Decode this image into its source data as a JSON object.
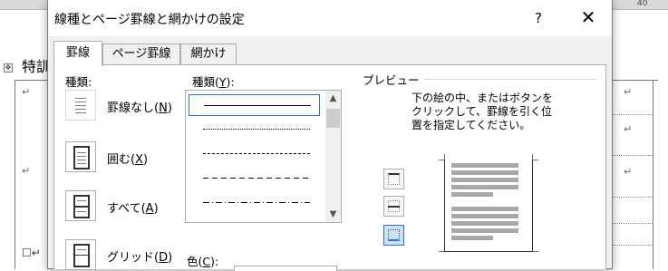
{
  "document": {
    "ruler_number": "40",
    "text_fragment": "特訓",
    "paragraph_mark": "↵",
    "checkbox_row_mark": "☐↵"
  },
  "dialog": {
    "title": "線種とページ罫線と網かけの設定",
    "help_label": "?",
    "close_label": "✕",
    "tabs": [
      {
        "label": "罫線",
        "active": true
      },
      {
        "label": "ページ罫線",
        "active": false
      },
      {
        "label": "網かけ",
        "active": false
      }
    ],
    "settings": {
      "label": "種類:",
      "items": [
        {
          "label": "罫線なし(N)",
          "base": "罫線なし(",
          "key": "N",
          "end": ")",
          "icon": "no-border-icon"
        },
        {
          "label": "囲む(X)",
          "base": "囲む(",
          "key": "X",
          "end": ")",
          "icon": "box-border-icon"
        },
        {
          "label": "すべて(A)",
          "base": "すべて(",
          "key": "A",
          "end": ")",
          "icon": "all-borders-icon"
        },
        {
          "label": "グリッド(D)",
          "base": "グリッド(",
          "key": "D",
          "end": ")",
          "icon": "grid-border-icon"
        }
      ]
    },
    "style": {
      "label": "種類(Y):",
      "label_base": "種類(",
      "label_key": "Y",
      "label_end": "):",
      "items": [
        "solid",
        "dotted",
        "dashed-small",
        "dashed",
        "dash-dot"
      ],
      "selected": "solid"
    },
    "color": {
      "label": "色(C):",
      "label_base": "色(",
      "label_key": "C",
      "label_end": "):"
    },
    "preview": {
      "label": "プレビュー",
      "instructions": [
        "下の絵の中、またはボタンを",
        "クリックして、罫線を引く位",
        "置を指定してください。"
      ],
      "buttons": [
        "top-border-icon",
        "inside-horizontal-border-icon",
        "bottom-border-icon"
      ]
    },
    "colors": {
      "accent": "#2f73d1",
      "panel": "#f0f0f0",
      "border": "#adadad"
    }
  }
}
